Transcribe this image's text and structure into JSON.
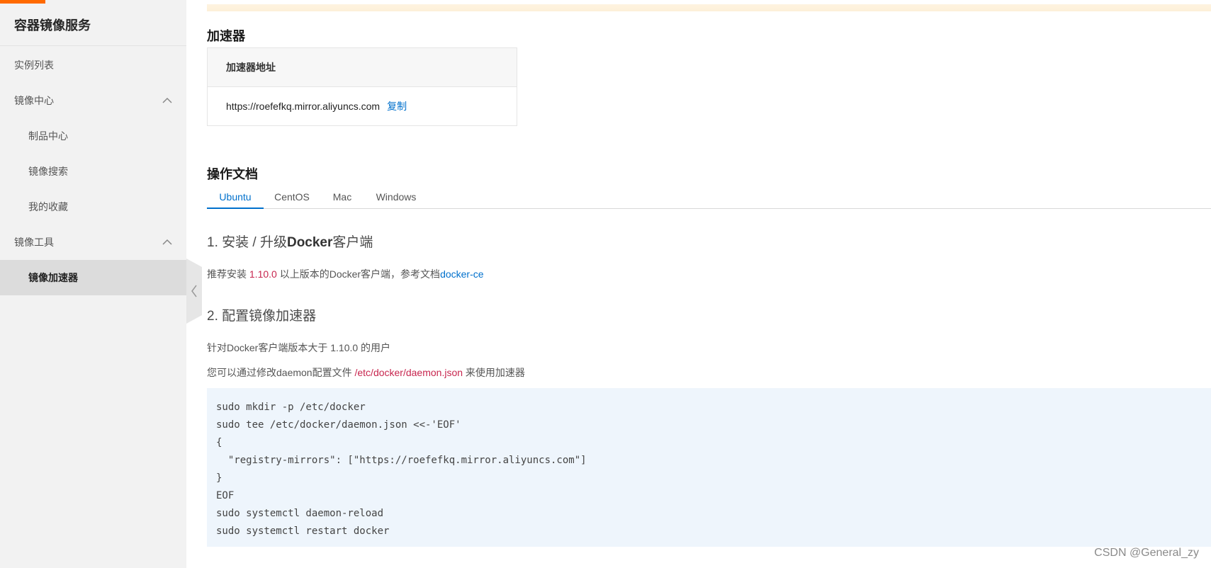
{
  "sidebar": {
    "title": "容器镜像服务",
    "items": [
      {
        "label": "实例列表"
      },
      {
        "label": "镜像中心"
      },
      {
        "label": "制品中心"
      },
      {
        "label": "镜像搜索"
      },
      {
        "label": "我的收藏"
      },
      {
        "label": "镜像工具"
      },
      {
        "label": "镜像加速器"
      }
    ]
  },
  "accelerator": {
    "section_title": "加速器",
    "table_header": "加速器地址",
    "address": "https://roefefkq.mirror.aliyuncs.com",
    "copy_label": "复制"
  },
  "docs": {
    "section_title": "操作文档",
    "tabs": [
      "Ubuntu",
      "CentOS",
      "Mac",
      "Windows"
    ],
    "active_tab": "Ubuntu",
    "step1": {
      "title_prefix": "1. 安装 / 升级",
      "title_bold": "Docker",
      "title_suffix": "客户端",
      "text_prefix": "推荐安装 ",
      "version": "1.10.0",
      "text_mid": " 以上版本的Docker客户端，参考文档",
      "link": "docker-ce"
    },
    "step2": {
      "title": "2. 配置镜像加速器",
      "line1": "针对Docker客户端版本大于 1.10.0 的用户",
      "line2_prefix": "您可以通过修改daemon配置文件 ",
      "config_path": "/etc/docker/daemon.json",
      "line2_suffix": " 来使用加速器",
      "code_lines": [
        "sudo mkdir -p /etc/docker",
        "sudo tee /etc/docker/daemon.json <<-'EOF'",
        "{",
        "  \"registry-mirrors\": [\"https://roefefkq.mirror.aliyuncs.com\"]",
        "}",
        "EOF",
        "sudo systemctl daemon-reload",
        "sudo systemctl restart docker"
      ]
    }
  },
  "watermark": "CSDN @General_zy",
  "colors": {
    "accent": "#ff6a00",
    "link": "#0070cc",
    "highlight": "#c7254e",
    "code_bg": "#eef5fc"
  },
  "icons": {
    "group_toggle": "chevron-up-icon",
    "sidebar_toggle": "chevron-left-icon"
  }
}
